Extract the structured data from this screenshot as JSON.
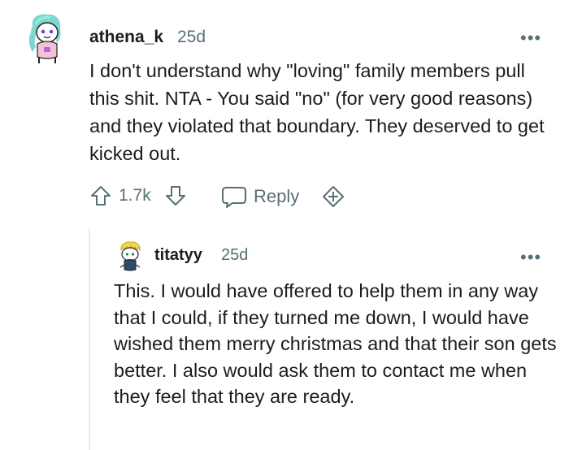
{
  "comment": {
    "author": "athena_k",
    "time": "25d",
    "more_label": "•••",
    "body": "I don't understand why \"loving\" family members pull this shit. NTA - You said \"no\" (for very good reasons) and they violated that boundary. They deserved to get kicked out.",
    "score": "1.7k",
    "reply_label": "Reply",
    "icons": {
      "avatar": "snoo-avatar-icon",
      "upvote": "upvote-arrow-icon",
      "downvote": "downvote-arrow-icon",
      "reply": "speech-bubble-icon",
      "award": "award-plus-icon",
      "more": "more-options-icon"
    }
  },
  "reply": {
    "author": "titatyy",
    "time": "25d",
    "more_label": "•••",
    "body": "This. I would have offered to help them in any way that I could, if they turned me down, I would have wished them merry christmas and that their son gets better. I also would ask them to contact me when they feel that they are ready."
  },
  "colors": {
    "text": "#1c1c1c",
    "meta": "#576f76",
    "thread_line": "#e5ebee"
  }
}
